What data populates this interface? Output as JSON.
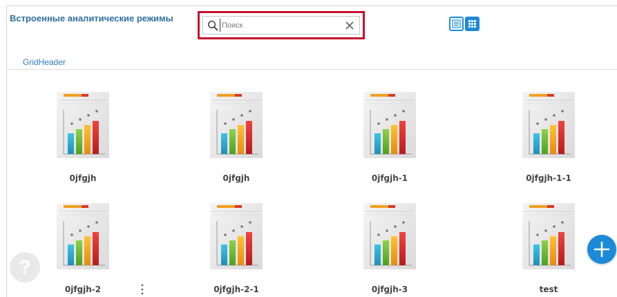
{
  "header": {
    "title": "Встроенные аналитические режимы",
    "search_placeholder": "Поиск",
    "search_value": ""
  },
  "section": {
    "label": "GridHeader"
  },
  "reports": [
    {
      "name": "0jfgjh"
    },
    {
      "name": "0jfgjh"
    },
    {
      "name": "0jfgjh-1"
    },
    {
      "name": "0jfgjh-1-1"
    },
    {
      "name": "0jfgjh-2"
    },
    {
      "name": "0jfgjh-2-1"
    },
    {
      "name": "0jfgjh-3"
    },
    {
      "name": "test"
    }
  ],
  "help": {
    "glyph": "?"
  },
  "icons": {
    "search": "search-icon",
    "clear": "close-icon",
    "list_view": "list-view-icon",
    "grid_view": "grid-view-icon",
    "thumbnail": "bar-chart-report-icon",
    "more": "more-vertical-icon",
    "help": "help-icon",
    "add": "plus-icon"
  },
  "colors": {
    "accent": "#1c8ad8",
    "title": "#2f6f9f",
    "highlight_border": "#c8102e"
  }
}
